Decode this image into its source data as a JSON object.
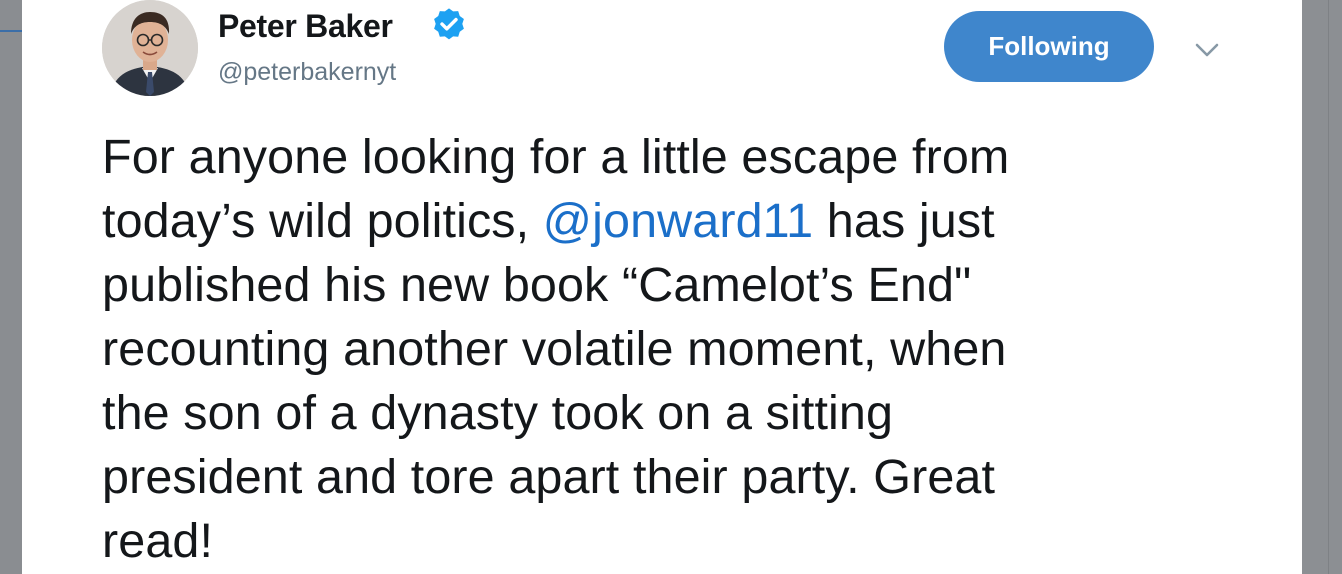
{
  "author": {
    "name": "Peter Baker",
    "handle": "@peterbakernyt",
    "verified_icon": "verified-badge-icon",
    "avatar_icon": "profile-photo"
  },
  "actions": {
    "follow_label": "Following",
    "menu_icon": "chevron-down-icon"
  },
  "tweet": {
    "line1": "For anyone looking for a little escape from",
    "line2_before": "today’s wild politics, ",
    "line2_mention": "@jonward11",
    "line2_after": " has just",
    "line3": "published his new book “Camelot’s End\"",
    "line4": "recounting another volatile moment, when",
    "line5": "the son of a dynasty took on a sitting",
    "line6": "president and tore apart their party. Great",
    "line7": "read!"
  },
  "colors": {
    "follow_button": "#3f86cc",
    "mention_link": "#1b6fc9",
    "verified_badge": "#1da1f2",
    "text_primary": "#14171a",
    "text_secondary": "#657786"
  }
}
